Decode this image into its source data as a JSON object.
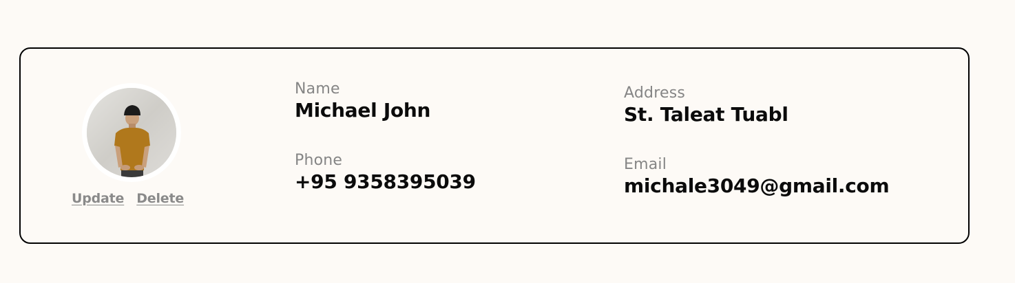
{
  "contact": {
    "actions": {
      "update_label": "Update",
      "delete_label": "Delete"
    },
    "fields": {
      "name": {
        "label": "Name",
        "value": "Michael John"
      },
      "phone": {
        "label": "Phone",
        "value": "+95 9358395039"
      },
      "address": {
        "label": "Address",
        "value": "St.  Taleat Tuabl"
      },
      "email": {
        "label": "Email",
        "value": "michale3049@gmail.com"
      }
    }
  },
  "colors": {
    "background": "#fdfaf6",
    "border": "#000000",
    "label": "#858585",
    "value": "#0b0b0b",
    "action": "#8a8a8a",
    "shirt": "#b0781c"
  }
}
